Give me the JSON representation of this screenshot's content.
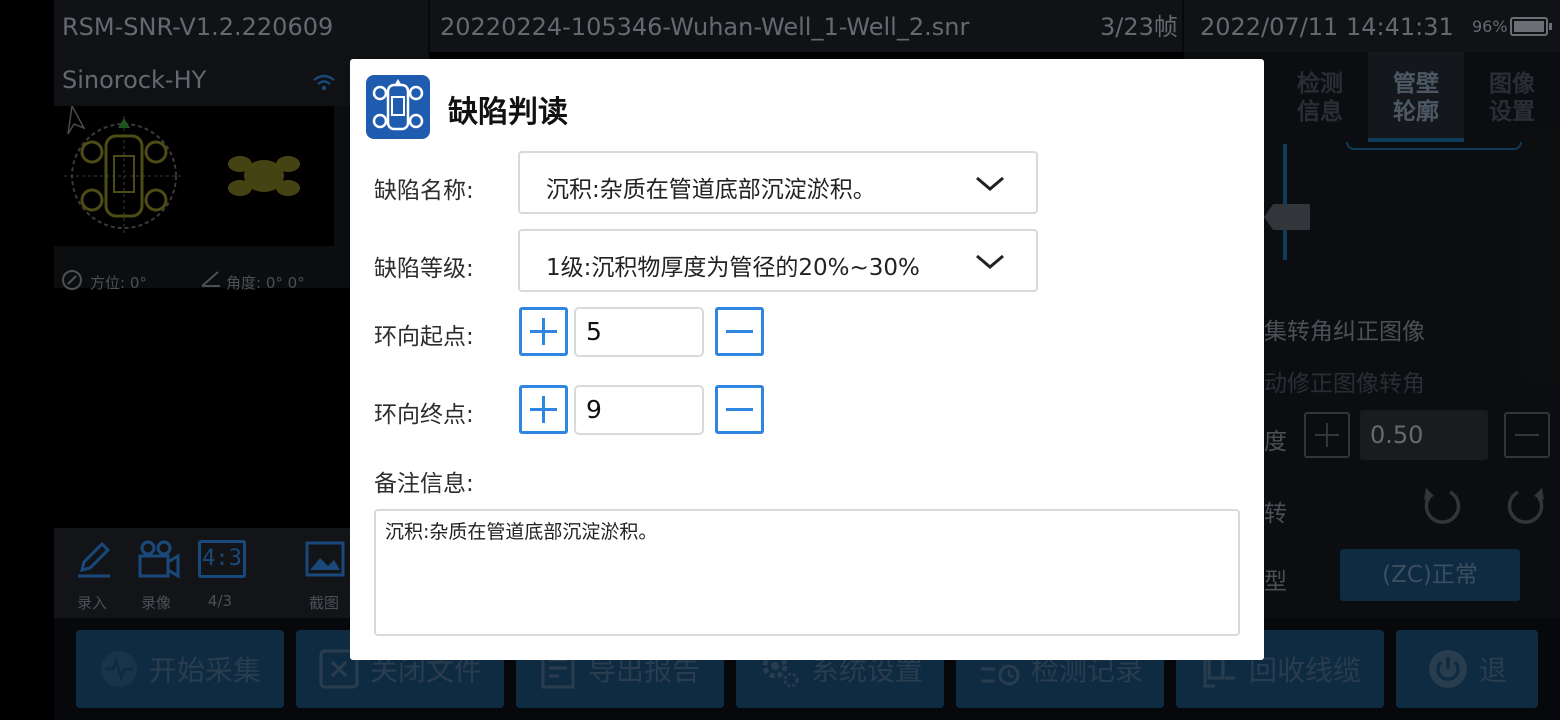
{
  "statusbar": {
    "version": "RSM-SNR-V1.2.220609",
    "filename": "20220224-105346-Wuhan-Well_1-Well_2.snr",
    "frame": "3/23帧",
    "datetime": "2022/07/11 14:41:31",
    "battery": "96%"
  },
  "left": {
    "device": "Sinorock-HY",
    "azimuth": "方位: 0°",
    "angle": "角度: 0° 0°"
  },
  "right_panel": {
    "tabs": [
      {
        "label": "检测\n信息"
      },
      {
        "label": "管壁\n轮廓",
        "active": true
      },
      {
        "label": "图像\n设置"
      }
    ],
    "heading": "集转角纠正图像",
    "subheading": "动修正图像转角",
    "speed_label": "度",
    "speed_value": "0.50",
    "rotate_label": "转",
    "type_label": "型",
    "type_value": "(ZC)正常"
  },
  "tools": [
    {
      "label": "录入",
      "icon": "pencil-icon"
    },
    {
      "label": "录像",
      "icon": "video-icon"
    },
    {
      "label": "4/3",
      "icon": "aspect-ratio-icon",
      "icon_text": "4:3"
    },
    {
      "label": "截图",
      "icon": "screenshot-icon"
    }
  ],
  "bottom_buttons": [
    {
      "label": "开始采集",
      "icon": "pulse-icon"
    },
    {
      "label": "关闭文件",
      "icon": "close-file-icon"
    },
    {
      "label": "导出报告",
      "icon": "report-icon"
    },
    {
      "label": "系统设置",
      "icon": "gear-icon"
    },
    {
      "label": "检测记录",
      "icon": "record-list-icon"
    },
    {
      "label": "回收线缆",
      "icon": "cable-icon"
    },
    {
      "label": "退",
      "icon": "power-icon"
    }
  ],
  "dialog": {
    "title": "缺陷判读",
    "defect_name_label": "缺陷名称:",
    "defect_name_value": "沉积:杂质在管道底部沉淀淤积。",
    "defect_level_label": "缺陷等级:",
    "defect_level_value": "1级:沉积物厚度为管径的20%~30%",
    "circ_start_label": "环向起点:",
    "circ_start_value": "5",
    "circ_end_label": "环向终点:",
    "circ_end_value": "9",
    "notes_label": "备注信息:",
    "notes_value": "沉积:杂质在管道底部沉淀淤积。"
  },
  "colors": {
    "accent": "#2f86e0",
    "dialog_icon_bg": "#1f5cb0",
    "button_bg": "#1b4f78"
  }
}
